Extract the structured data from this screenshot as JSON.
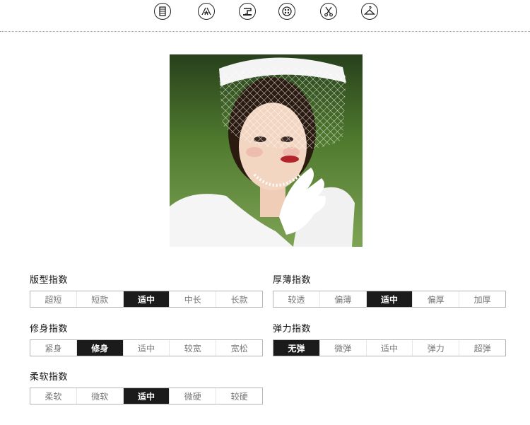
{
  "icons": [
    "sewing-needle-icon",
    "scissors-tools-icon",
    "sewing-machine-icon",
    "button-icon",
    "scissors-icon",
    "hanger-icon"
  ],
  "colors": {
    "selected": "#1b1b1b",
    "text": "#777777",
    "border": "#b5b5b5"
  },
  "scales": [
    {
      "id": "fit",
      "title": "版型指数",
      "options": [
        "超短",
        "短款",
        "适中",
        "中长",
        "长款"
      ],
      "selected": 2
    },
    {
      "id": "thickness",
      "title": "厚薄指数",
      "options": [
        "较透",
        "偏薄",
        "适中",
        "偏厚",
        "加厚"
      ],
      "selected": 2
    },
    {
      "id": "slim",
      "title": "修身指数",
      "options": [
        "紧身",
        "修身",
        "适中",
        "较宽",
        "宽松"
      ],
      "selected": 1
    },
    {
      "id": "elasticity",
      "title": "弹力指数",
      "options": [
        "无弹",
        "微弹",
        "适中",
        "弹力",
        "超弹"
      ],
      "selected": 0
    },
    {
      "id": "softness",
      "title": "柔软指数",
      "options": [
        "柔软",
        "微软",
        "适中",
        "微硬",
        "较硬"
      ],
      "selected": 2
    }
  ]
}
